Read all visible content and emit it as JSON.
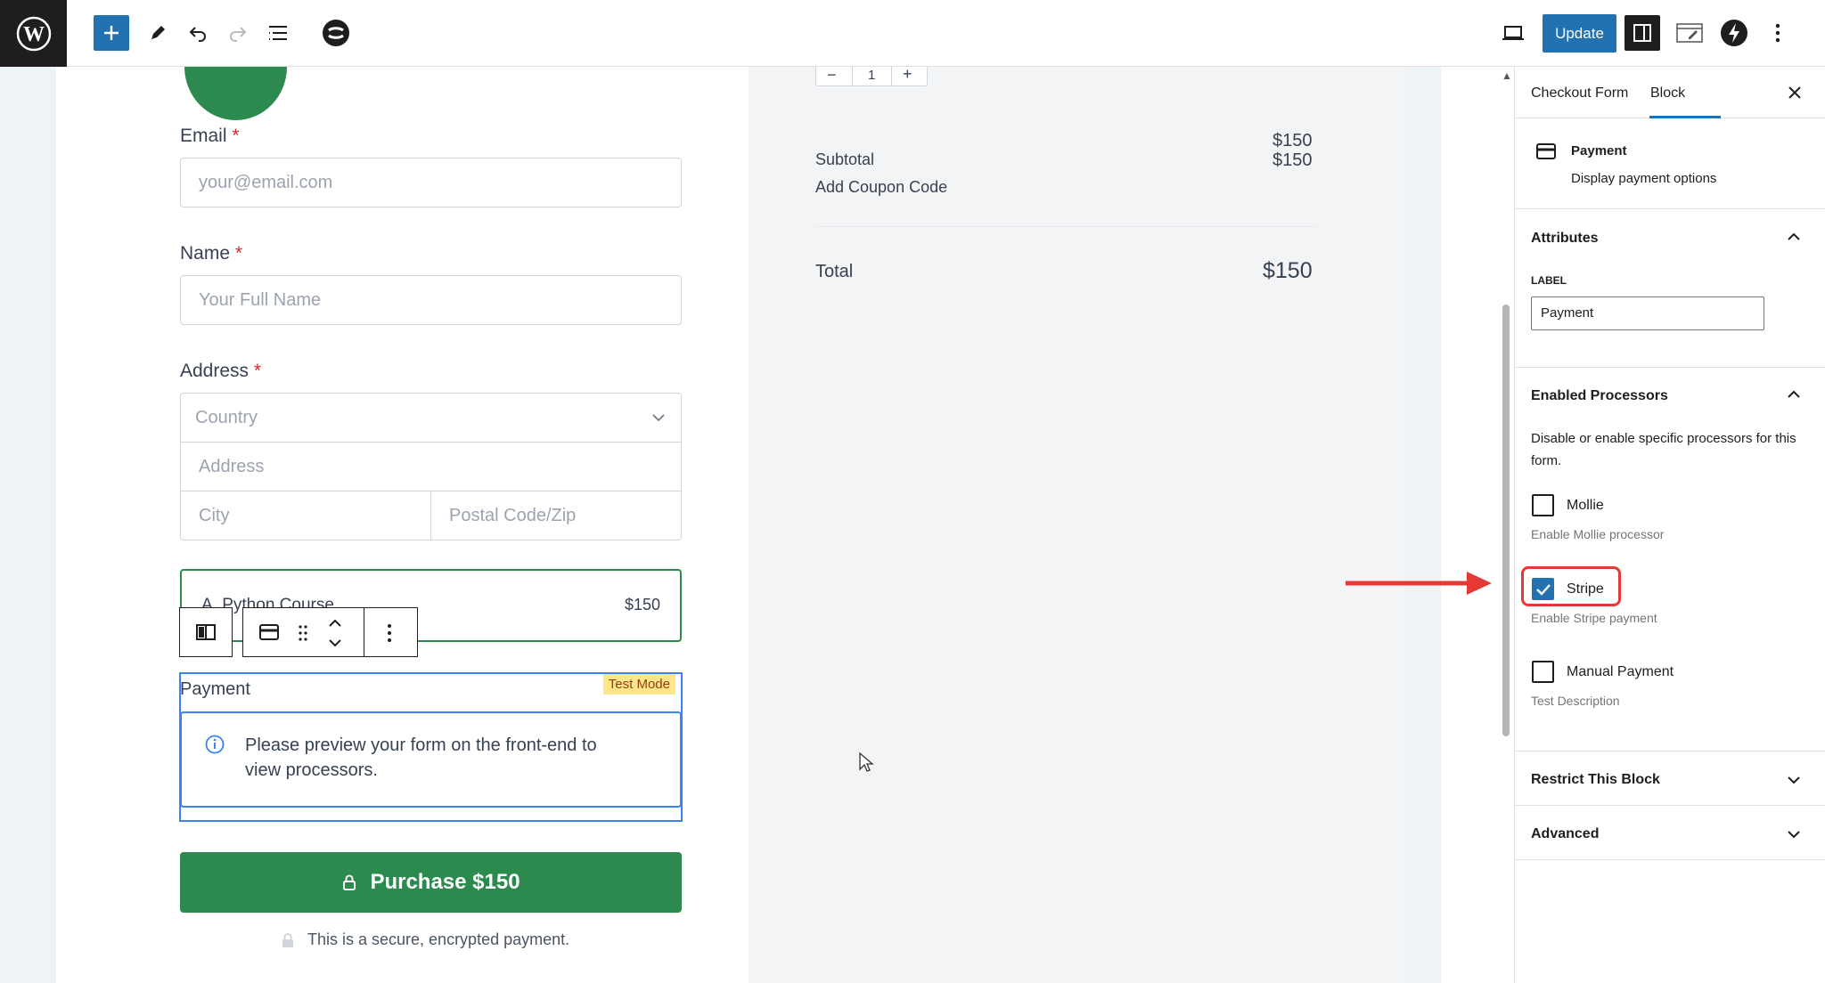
{
  "toolbar": {
    "update_label": "Update"
  },
  "form": {
    "email_label": "Email",
    "email_placeholder": "your@email.com",
    "name_label": "Name",
    "name_placeholder": "Your Full Name",
    "address_label": "Address",
    "country_placeholder": "Country",
    "address_placeholder": "Address",
    "city_placeholder": "City",
    "postal_placeholder": "Postal Code/Zip",
    "required_mark": "*",
    "product_name": "A. Python Course",
    "product_price": "$150",
    "payment_label": "Payment",
    "test_mode_badge": "Test Mode",
    "payment_notice": "Please preview your form on the front-end to view processors.",
    "purchase_label": "Purchase $150",
    "secure_note": "This is a secure, encrypted payment."
  },
  "summary": {
    "quantity": "1",
    "line_price": "$150",
    "subtotal_label": "Subtotal",
    "subtotal_value": "$150",
    "coupon_label": "Add Coupon Code",
    "total_label": "Total",
    "total_value": "$150"
  },
  "sidebar": {
    "tabs": [
      "Checkout Form",
      "Block"
    ],
    "active_tab": "Block",
    "block_title": "Payment",
    "block_desc": "Display payment options",
    "attributes_title": "Attributes",
    "label_caption": "LABEL",
    "label_value": "Payment",
    "processors_title": "Enabled Processors",
    "processors_desc": "Disable or enable specific processors for this form.",
    "processors": [
      {
        "label": "Mollie",
        "help": "Enable Mollie processor",
        "checked": false
      },
      {
        "label": "Stripe",
        "help": "Enable Stripe payment",
        "checked": true
      },
      {
        "label": "Manual Payment",
        "help": "Test Description",
        "checked": false
      }
    ],
    "restrict_title": "Restrict This Block",
    "advanced_title": "Advanced"
  },
  "colors": {
    "accent": "#2271b1",
    "purchase_green": "#2d8a4e",
    "highlight_red": "#e53935"
  }
}
